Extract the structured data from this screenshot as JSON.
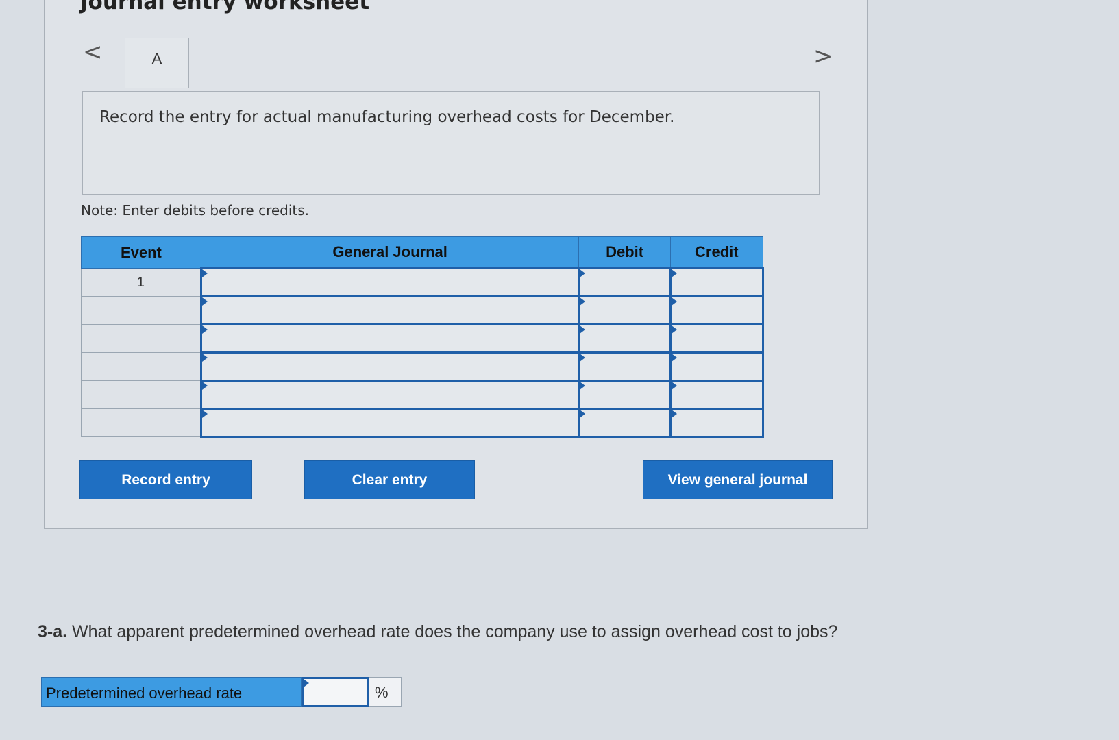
{
  "worksheet": {
    "title": "Journal entry worksheet",
    "nav_prev": "<",
    "nav_next": ">",
    "tab_label": "A",
    "prompt": "Record the entry for actual manufacturing overhead costs for December.",
    "note": "Note: Enter debits before credits."
  },
  "journal": {
    "headers": [
      "Event",
      "General Journal",
      "Debit",
      "Credit"
    ],
    "rows": [
      {
        "event": "1",
        "account": "",
        "debit": "",
        "credit": ""
      },
      {
        "event": "",
        "account": "",
        "debit": "",
        "credit": ""
      },
      {
        "event": "",
        "account": "",
        "debit": "",
        "credit": ""
      },
      {
        "event": "",
        "account": "",
        "debit": "",
        "credit": ""
      },
      {
        "event": "",
        "account": "",
        "debit": "",
        "credit": ""
      },
      {
        "event": "",
        "account": "",
        "debit": "",
        "credit": ""
      }
    ]
  },
  "buttons": {
    "record": "Record entry",
    "clear": "Clear entry",
    "view": "View general journal"
  },
  "question": {
    "number": "3-a.",
    "text": "What apparent predetermined overhead rate does the company use to assign overhead cost to jobs?"
  },
  "rate": {
    "label": "Predetermined overhead rate",
    "value": "",
    "unit": "%"
  },
  "colors": {
    "header_blue": "#3d9be2",
    "button_blue": "#1f6fc2",
    "cell_border_blue": "#1f5fa8"
  }
}
